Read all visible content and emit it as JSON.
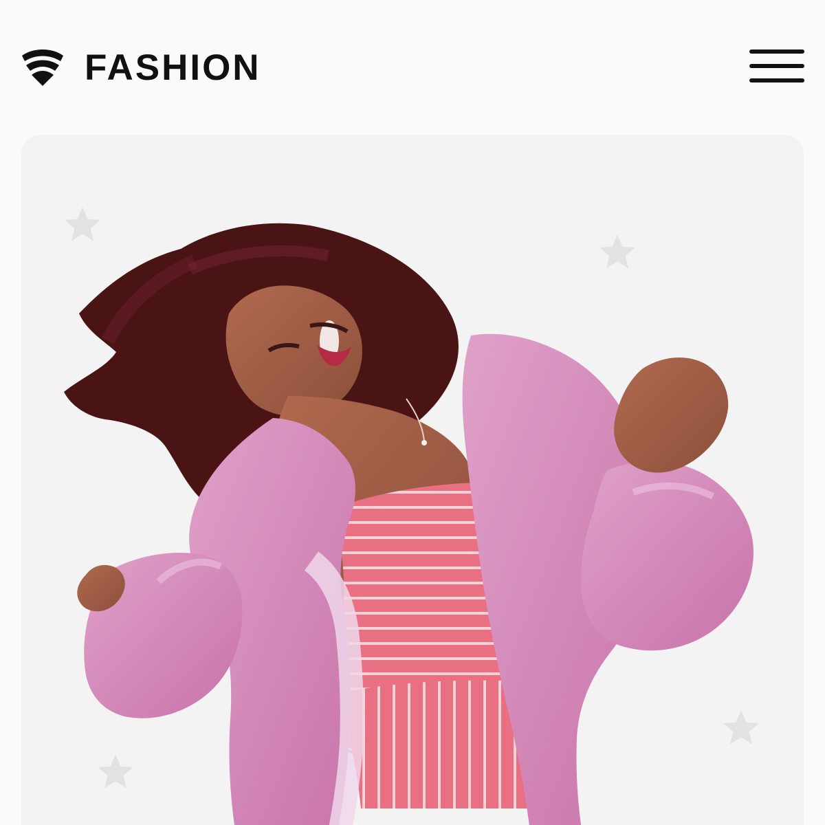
{
  "brand": {
    "name": "FASHION",
    "logo_icon": "shield-wave-icon"
  },
  "header": {
    "menu_icon": "hamburger-menu-icon"
  },
  "hero": {
    "background_color": "#f3f3f3",
    "decor_icon": "star-icon",
    "image_subject": "hero-photo"
  },
  "colors": {
    "text": "#111111",
    "page_bg": "#fafafa",
    "coat_pink": "#d58aba",
    "dress_red": "#e0687a"
  }
}
